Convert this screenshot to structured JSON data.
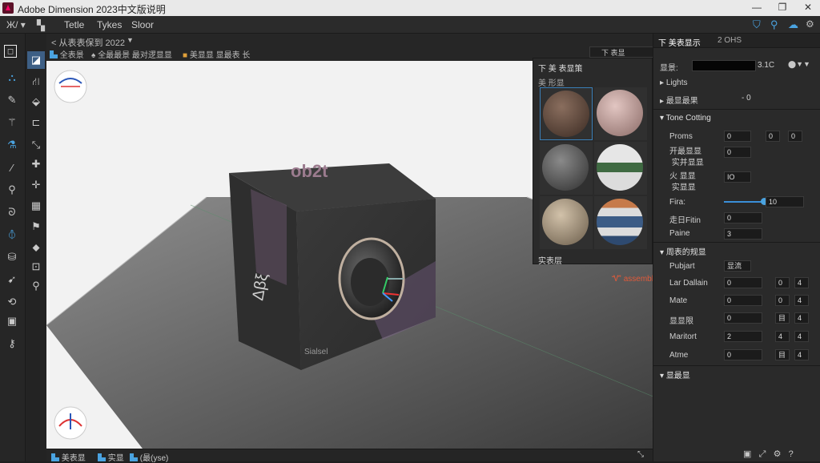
{
  "window": {
    "title": "Adobe Dimension 2023中文版说明"
  },
  "menubar": {
    "left_label": "Ж/ ▾",
    "items": [
      "Tetle",
      "Tykes",
      "Sloor"
    ]
  },
  "doc": {
    "title": "< 从表表保到 2022",
    "tabs": [
      "全表景",
      "全最最景 最对逻显显",
      "美显显 显最表 长"
    ],
    "panel_tab": "下 表显"
  },
  "viewport": {
    "box_brand": "ob2t",
    "box_side": "Δβξ",
    "box_bottom_label": "Sialsel",
    "right_note": "Ꮙ assembl"
  },
  "materials": {
    "header": "下 美 表显策",
    "subheader": "美 形显",
    "footer": "实表层",
    "balls": [
      {
        "name": "brown-fabric",
        "color": "#6b5547"
      },
      {
        "name": "pink-fabric",
        "color": "#c8a6a2"
      },
      {
        "name": "grey-knit",
        "color": "#6d6d6d"
      },
      {
        "name": "green-stripe",
        "color": "#c9cfc5"
      },
      {
        "name": "beige-fabric",
        "color": "#b1a08b"
      },
      {
        "name": "blue-stripe",
        "color": "#4a5c7a"
      }
    ]
  },
  "rightpanel": {
    "tabs": [
      "下 美表显示",
      "2 OHS"
    ],
    "scene_label": "显景:",
    "scene_value": "3.1C",
    "lights_label": "Lights",
    "env_label": "最显最果",
    "env_value": "- 0",
    "tone_section": "Tone Cotting",
    "tone_rows": [
      {
        "label": "Proms",
        "value": "0",
        "value2": "0",
        "value3": "0"
      },
      {
        "label": "开最显显 \n 实并显显",
        "value": "0"
      },
      {
        "label": "火 显显\n 实显显",
        "value": "IO"
      },
      {
        "label": "Fira:",
        "value": "10"
      },
      {
        "label": "走日Fitin",
        "value": "0"
      },
      {
        "label": "Paine",
        "value": "3"
      }
    ],
    "prop_section": "周表的规显",
    "prop_rows": [
      {
        "label": "Pubjart",
        "value": "显流"
      },
      {
        "label": "Lar Dallain",
        "value": "0",
        "a": "0",
        "b": "4"
      },
      {
        "label": "Mate",
        "value": "0",
        "a": "0",
        "b": "4"
      },
      {
        "label": "显显限",
        "value": "0",
        "a": "目",
        "b": "4"
      },
      {
        "label": "Maritort",
        "value": "2",
        "a": "4",
        "b": "4"
      },
      {
        "label": "Atme",
        "value": "0",
        "a": "目",
        "b": "4"
      }
    ],
    "last_section": "显最显"
  },
  "status": {
    "items": [
      "美表显",
      "实显",
      "(最(ysе)"
    ]
  }
}
